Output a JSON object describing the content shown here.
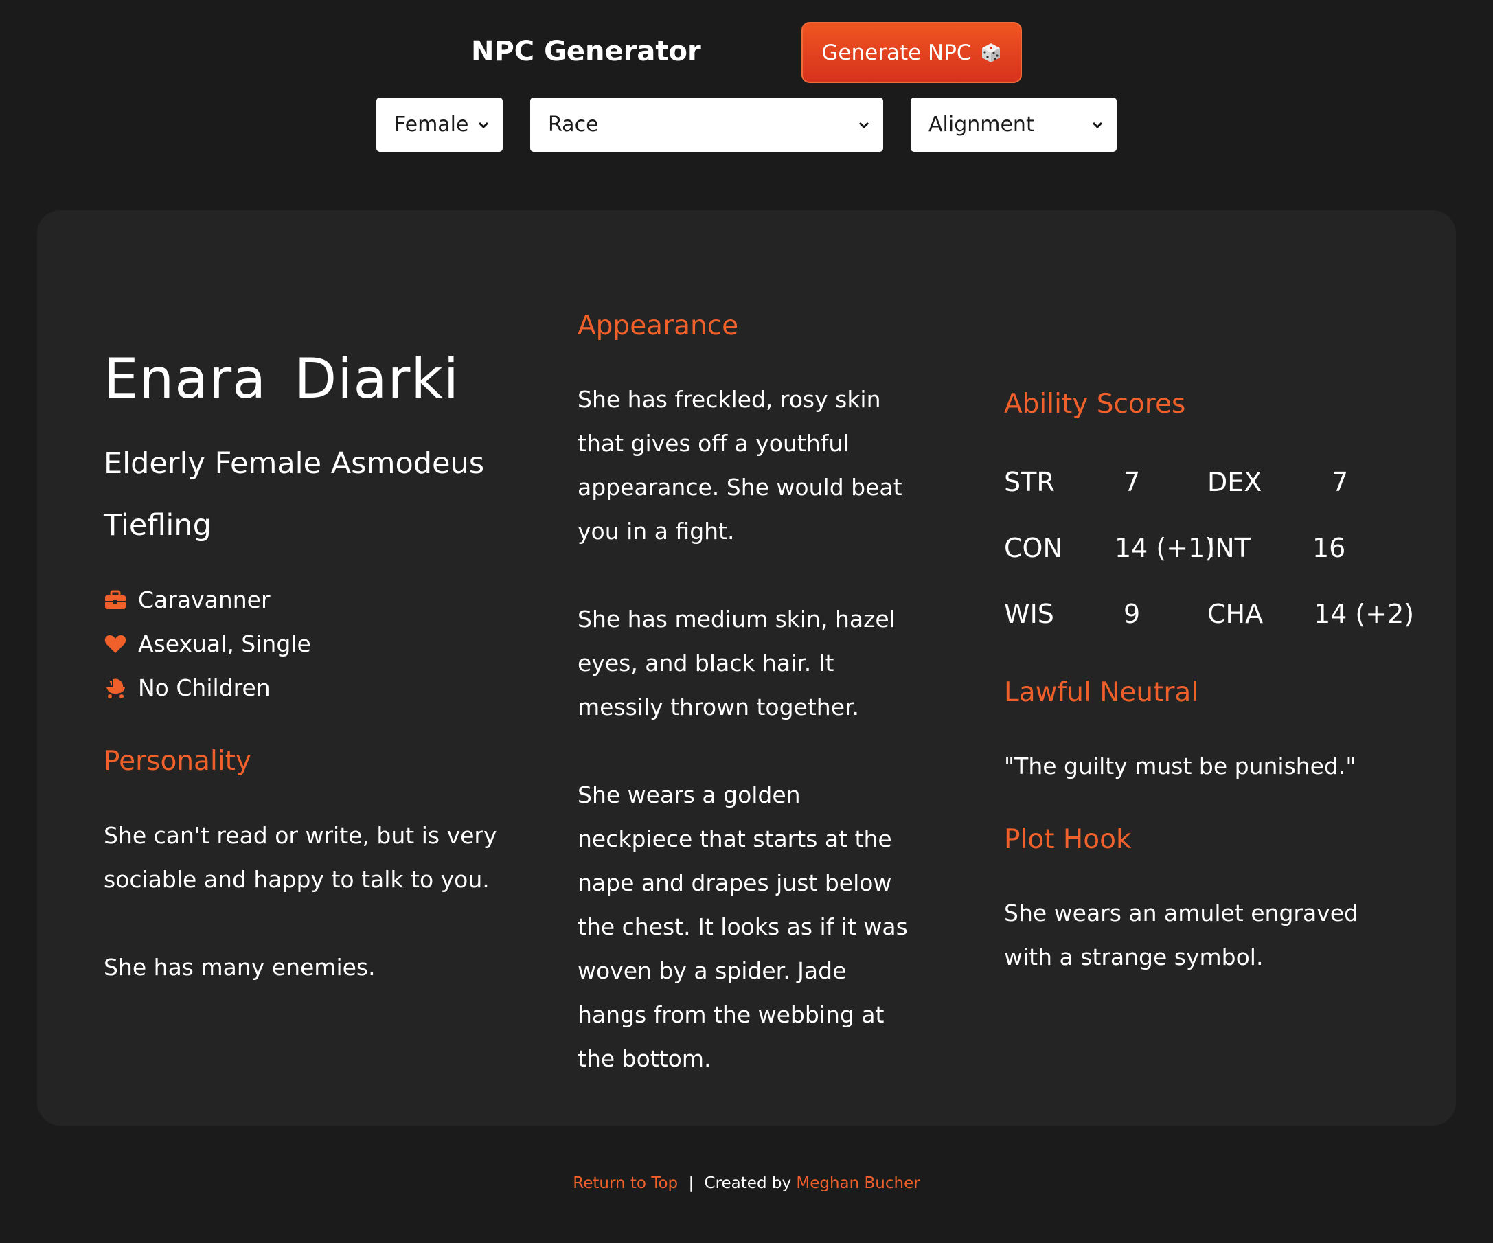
{
  "header": {
    "title": "NPC Generator",
    "generate_label": "Generate NPC"
  },
  "filters": {
    "gender": "Female",
    "race": "Race",
    "alignment": "Alignment"
  },
  "npc": {
    "name": "Enara Diarki",
    "descriptor": "Elderly Female Asmodeus Tiefling",
    "occupation": "Caravanner",
    "relationship": "Asexual, Single",
    "children": "No Children"
  },
  "personality": {
    "heading": "Personality",
    "traits": "She can't read or write, but is very sociable and happy to talk to you.",
    "extra": "She has many enemies."
  },
  "appearance": {
    "heading": "Appearance",
    "p1": "She has freckled, rosy skin that gives off a youthful appearance. She would beat you in a fight.",
    "p2": "She has medium skin, hazel eyes, and black hair. It messily thrown together.",
    "p3": "She wears a golden neckpiece that starts at the nape and drapes just below the chest. It looks as if it was woven by a spider. Jade hangs from the webbing at the bottom."
  },
  "abilities": {
    "heading": "Ability Scores",
    "str_label": "STR",
    "str_value": "7",
    "dex_label": "DEX",
    "dex_value": "7",
    "con_label": "CON",
    "con_value": "14 (+1)",
    "int_label": "INT",
    "int_value": "16",
    "wis_label": "WIS",
    "wis_value": "9",
    "cha_label": "CHA",
    "cha_value": "14 (+2)"
  },
  "alignment": {
    "heading": "Lawful Neutral",
    "quote": "\"The guilty must be punished.\""
  },
  "plot": {
    "heading": "Plot Hook",
    "text": "She wears an amulet engraved with a strange symbol."
  },
  "footer": {
    "return_label": "Return to Top",
    "separator": "|",
    "created_by": "Created by",
    "author": "Meghan Bucher"
  },
  "colors": {
    "accent": "#f0602a",
    "page_bg": "#1b1b1b",
    "card_bg": "#242424",
    "button_top": "#ef5520",
    "button_bottom": "#d7321e"
  },
  "icons": {
    "occupation": "briefcase-icon",
    "relationship": "heart-icon",
    "children": "stroller-icon",
    "generate": "dice-icon",
    "select": "chevron-down-icon"
  }
}
